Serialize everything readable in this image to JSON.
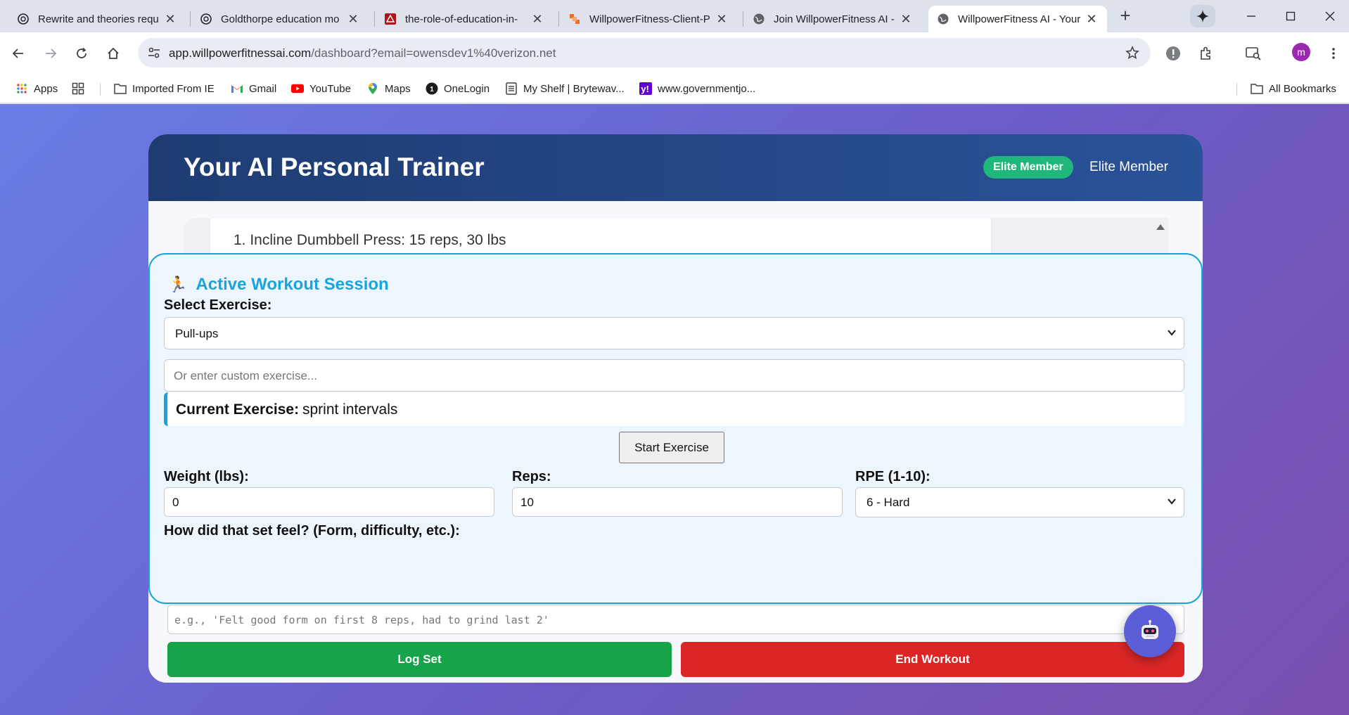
{
  "browser": {
    "tabs": [
      {
        "title": "Rewrite and theories requ",
        "icon": "chatgpt-icon"
      },
      {
        "title": "Goldthorpe education mo",
        "icon": "chatgpt-icon"
      },
      {
        "title": "the-role-of-education-in-",
        "icon": "pdf-icon"
      },
      {
        "title": "WillpowerFitness-Client-P",
        "icon": "app-icon"
      },
      {
        "title": "Join WillpowerFitness AI -",
        "icon": "globe-icon"
      },
      {
        "title": "WillpowerFitness AI - Your",
        "icon": "globe-icon",
        "active": true
      }
    ],
    "url_host": "app.willpowerfitnessai.com",
    "url_path": "/dashboard?email=owensdev1%40verizon.net",
    "profile_initial": "m",
    "bookmarks": [
      {
        "label": "Apps",
        "icon": "apps-grid-icon"
      },
      {
        "label": "Imported From IE",
        "icon": "folder-icon"
      },
      {
        "label": "Gmail",
        "icon": "gmail-icon"
      },
      {
        "label": "YouTube",
        "icon": "youtube-icon"
      },
      {
        "label": "Maps",
        "icon": "maps-icon"
      },
      {
        "label": "OneLogin",
        "icon": "onelogin-icon"
      },
      {
        "label": "My Shelf | Brytewav...",
        "icon": "shelf-icon"
      },
      {
        "label": "www.governmentjo...",
        "icon": "yahoo-icon"
      }
    ],
    "all_bookmarks": "All Bookmarks"
  },
  "app": {
    "title": "Your AI Personal Trainer",
    "badge": "Elite Member",
    "member_text": "Elite Member",
    "history_line": "1. Incline Dumbbell Press: 15 reps, 30 lbs",
    "session": {
      "title": "Active Workout Session",
      "select_exercise_label": "Select Exercise:",
      "selected_exercise": "Pull-ups",
      "custom_placeholder": "Or enter custom exercise...",
      "current_label": "Current Exercise:",
      "current_value": "sprint intervals",
      "start_button": "Start Exercise",
      "weight_label": "Weight (lbs):",
      "weight_value": "0",
      "reps_label": "Reps:",
      "reps_value": "10",
      "rpe_label": "RPE (1-10):",
      "rpe_value": "6 - Hard",
      "feel_label": "How did that set feel? (Form, difficulty, etc.):",
      "feel_placeholder": "e.g., 'Felt good form on first 8 reps, had to grind last 2'"
    },
    "log_button": "Log Set",
    "end_button": "End Workout"
  },
  "colors": {
    "header_start": "#1e3c72",
    "header_end": "#2a5298",
    "accent": "#19a4d6",
    "badge": "#1fb77a",
    "log": "#16a34a",
    "end": "#dc2626"
  }
}
